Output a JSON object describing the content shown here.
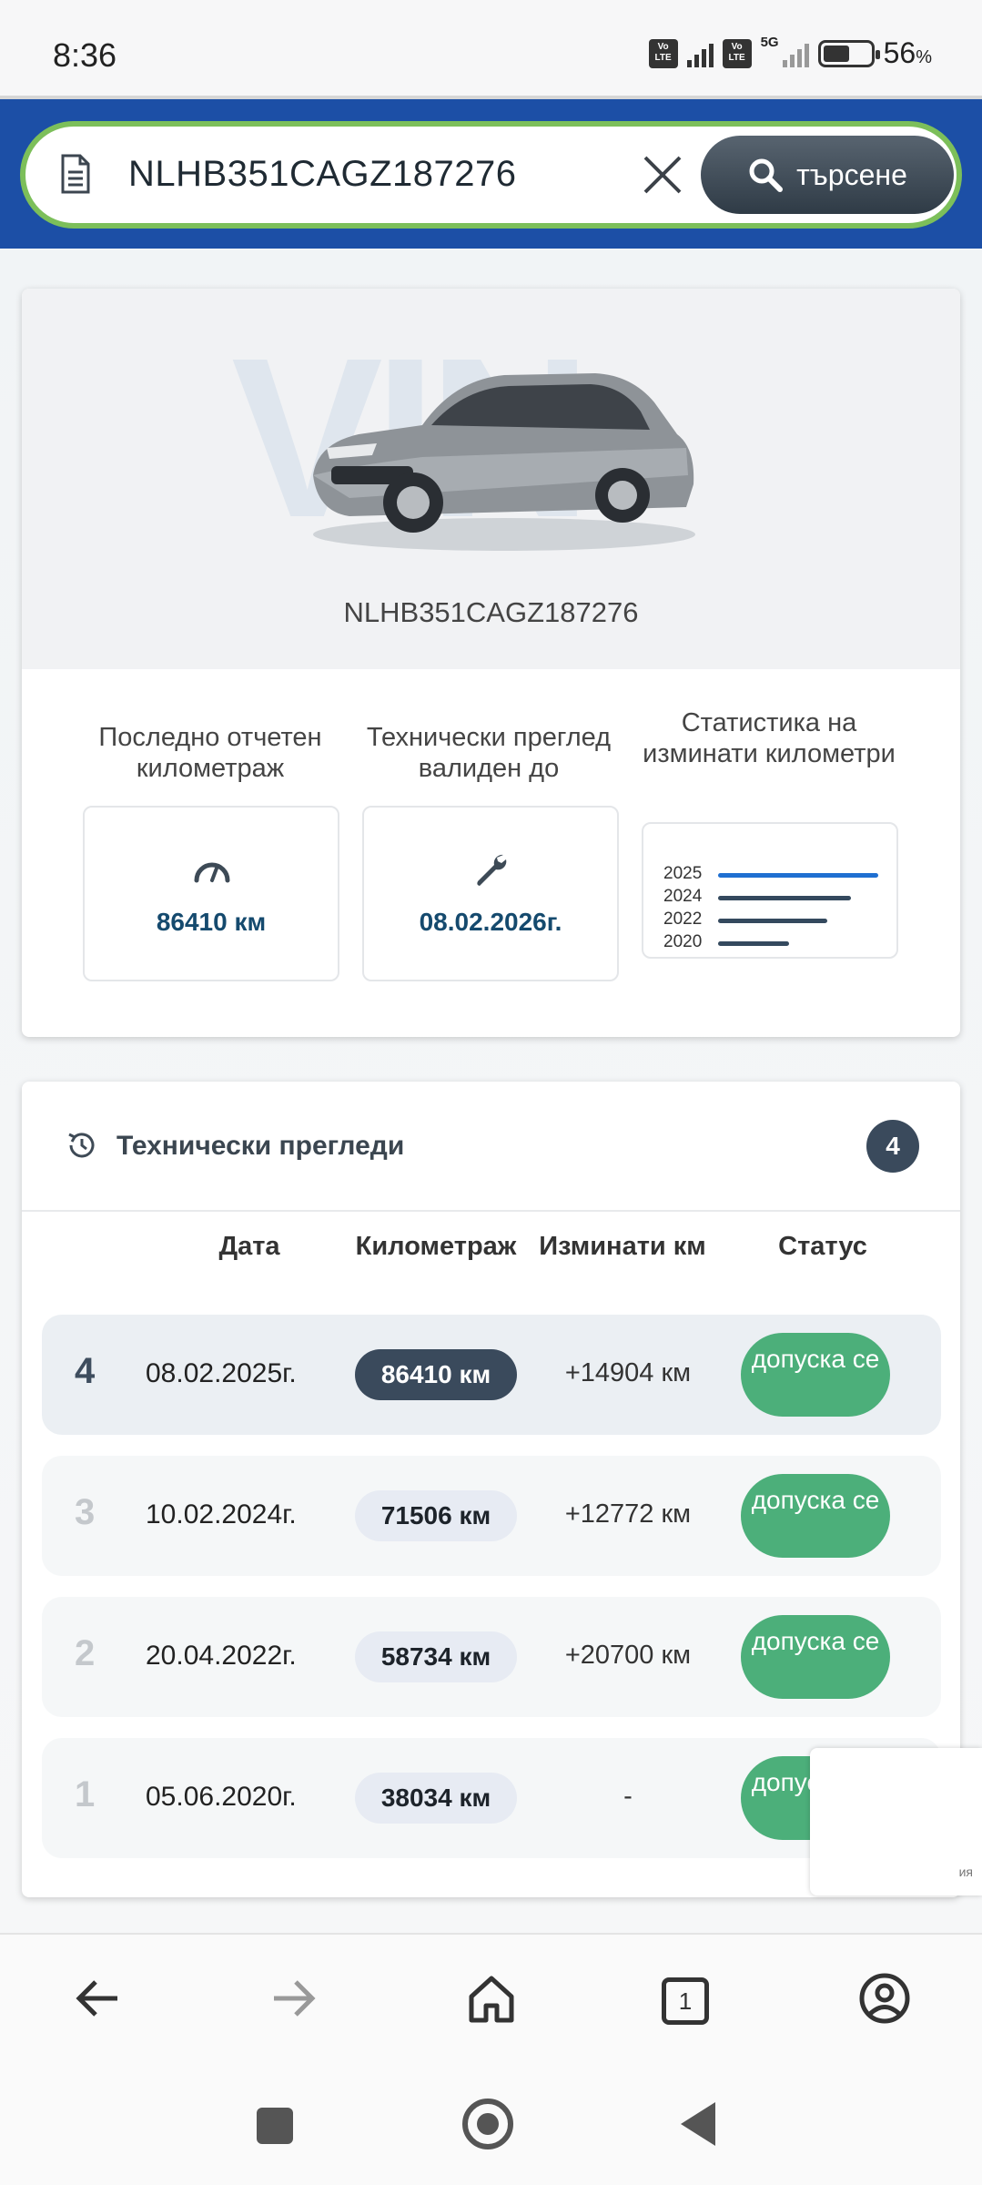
{
  "status_bar": {
    "time": "8:36",
    "volte1": "Vo LTE",
    "volte2": "Vo LTE",
    "network": "5G",
    "battery_percent": 56,
    "battery_text": "56",
    "battery_unit": "%"
  },
  "search": {
    "value": "NLHB351CAGZ187276",
    "button_label": "търсене",
    "icons": {
      "document": "document-icon",
      "clear": "close-icon",
      "search": "search-icon"
    }
  },
  "vehicle": {
    "vin": "NLHB351CAGZ187276",
    "watermark": "VIN"
  },
  "stats": {
    "mileage_label": "Последно отчетен километраж",
    "mileage_value": "86410 км",
    "inspection_label": "Технически преглед валиден до",
    "inspection_value": "08.02.2026г.",
    "chart_label": "Статистика на изминати километри",
    "chart_years": [
      "2025",
      "2024",
      "2022",
      "2020"
    ]
  },
  "inspections": {
    "title": "Технически прегледи",
    "count": "4",
    "headers": {
      "date": "Дата",
      "mileage": "Километраж",
      "diff": "Изминати км",
      "status": "Статус"
    },
    "rows": [
      {
        "num": "4",
        "date": "08.02.2025г.",
        "km": "86410 км",
        "diff": "+14904 км",
        "status": "допуска се"
      },
      {
        "num": "3",
        "date": "10.02.2024г.",
        "km": "71506 км",
        "diff": "+12772 км",
        "status": "допуска се"
      },
      {
        "num": "2",
        "date": "20.04.2022г.",
        "km": "58734 км",
        "diff": "+20700 км",
        "status": "допуска се"
      },
      {
        "num": "1",
        "date": "05.06.2020г.",
        "km": "38034 км",
        "diff": "-",
        "status": "допуска се"
      }
    ]
  },
  "recaptcha": {
    "fragment": "ия"
  },
  "browser": {
    "tab_count": "1"
  },
  "colors": {
    "header_blue": "#1c4fa6",
    "search_border": "#7cbf5a",
    "status_green": "#4caf7a",
    "dark_slate": "#3a4a5c",
    "accent_blue": "#1f6fd1"
  }
}
